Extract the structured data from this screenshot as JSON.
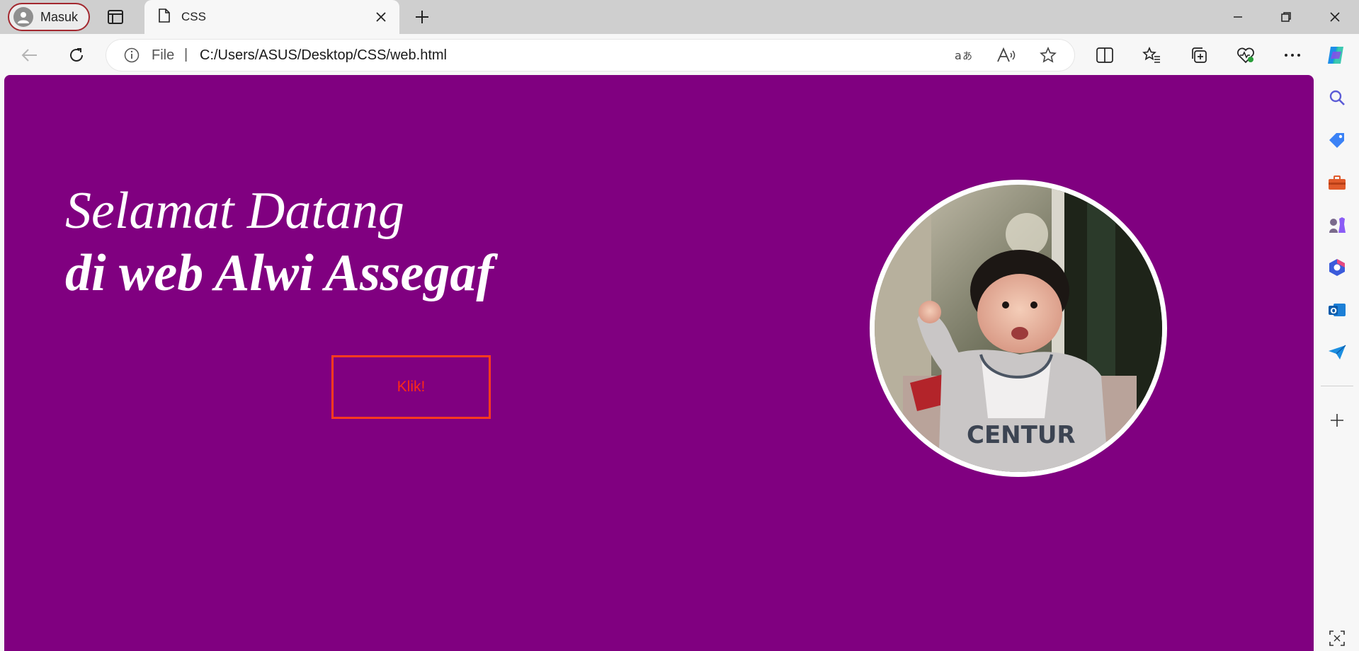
{
  "browser": {
    "profile_label": "Masuk",
    "tab_title": "CSS",
    "address_scheme": "File",
    "address_separator": "|",
    "address_url": "C:/Users/ASUS/Desktop/CSS/web.html",
    "accent_color": "#a3282f"
  },
  "page": {
    "background_color": "#800080",
    "heading_line1": "Selamat Datang",
    "heading_line2": "di web Alwi Assegaf",
    "button_label": "Klik!",
    "button_color": "#ff3b1f"
  },
  "sidebar": {
    "items": [
      "search-icon",
      "shopping-tag-icon",
      "tools-icon",
      "games-icon",
      "microsoft365-icon",
      "outlook-icon",
      "drop-icon",
      "add-icon",
      "screenshot-icon"
    ]
  }
}
